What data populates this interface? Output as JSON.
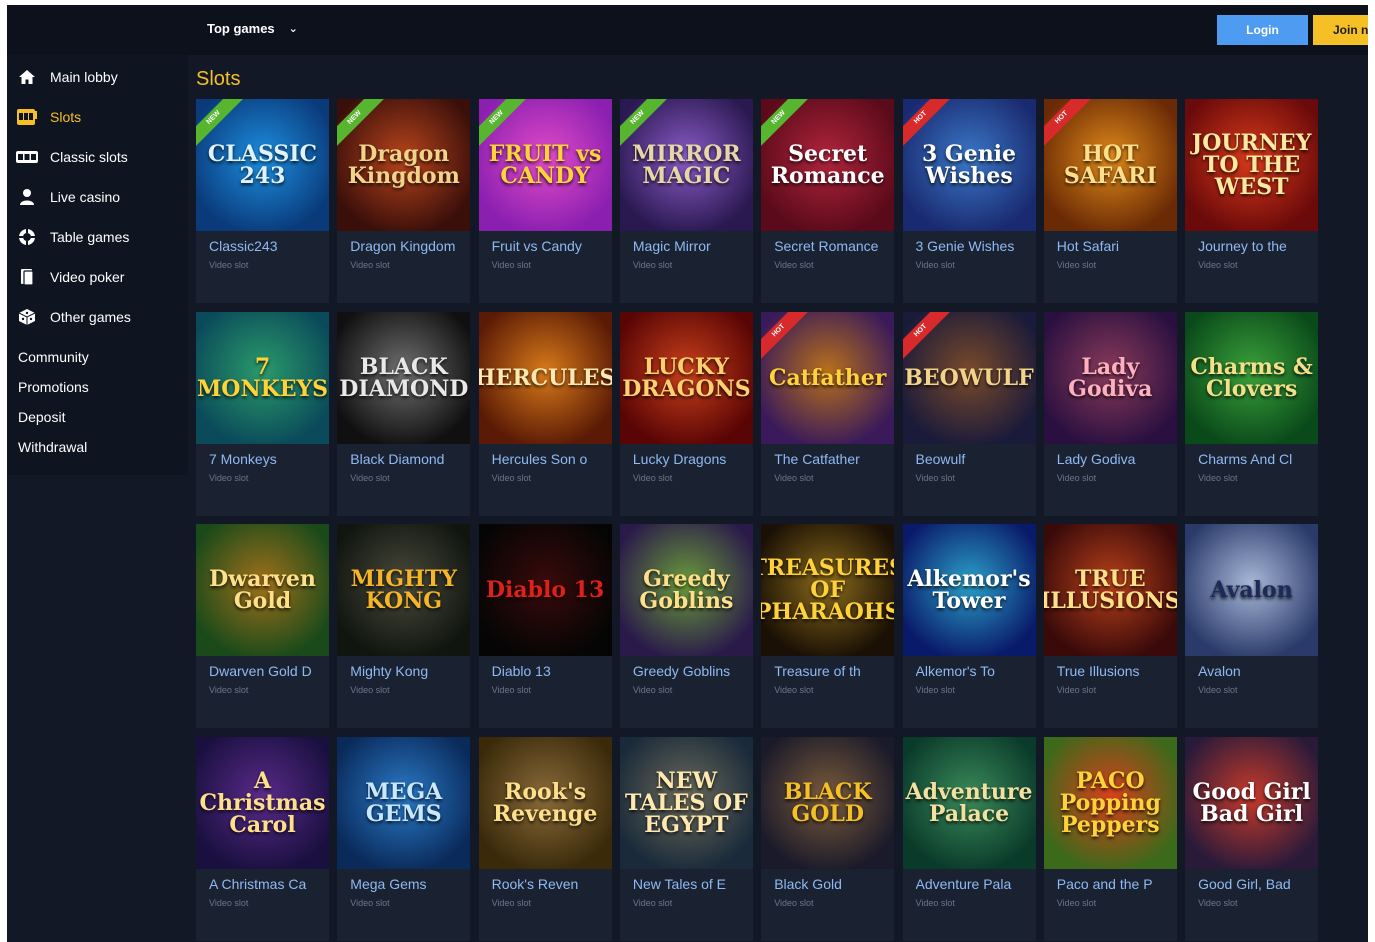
{
  "topbar": {
    "menu_label": "Top games",
    "login_label": "Login",
    "join_label": "Join n"
  },
  "sidebar": {
    "items": [
      {
        "label": "Main lobby",
        "icon": "home-icon",
        "active": false
      },
      {
        "label": "Slots",
        "icon": "slot-machine-icon",
        "active": true
      },
      {
        "label": "Classic slots",
        "icon": "classic-slots-icon",
        "active": false
      },
      {
        "label": "Live casino",
        "icon": "dealer-icon",
        "active": false
      },
      {
        "label": "Table games",
        "icon": "chip-icon",
        "active": false
      },
      {
        "label": "Video poker",
        "icon": "cards-icon",
        "active": false
      },
      {
        "label": "Other games",
        "icon": "dice-icon",
        "active": false
      }
    ],
    "links": [
      "Community",
      "Promotions",
      "Deposit",
      "Withdrawal"
    ]
  },
  "main": {
    "section_title": "Slots",
    "subtitle": "Video slot",
    "games": [
      {
        "name": "Classic243",
        "badge": "NEW",
        "art": "CLASSIC 243",
        "bg1": "#0a3a7a",
        "bg2": "#1c8fe0",
        "fg": "#dff3ff"
      },
      {
        "name": "Dragon Kingdom",
        "badge": "NEW",
        "art": "Dragon Kingdom",
        "bg1": "#3a0f0a",
        "bg2": "#b8441c",
        "fg": "#f2d38a"
      },
      {
        "name": "Fruit vs Candy",
        "badge": "NEW",
        "art": "FRUIT vs CANDY",
        "bg1": "#8a1fb0",
        "bg2": "#e24bc8",
        "fg": "#ffd23a"
      },
      {
        "name": "Magic Mirror",
        "badge": "NEW",
        "art": "MIRROR MAGIC",
        "bg1": "#2a1850",
        "bg2": "#8a5cc8",
        "fg": "#e8d6a8"
      },
      {
        "name": "Secret Romance",
        "badge": "NEW",
        "art": "Secret Romance",
        "bg1": "#5a0a1a",
        "bg2": "#b0243c",
        "fg": "#ffffff"
      },
      {
        "name": "3 Genie Wishes",
        "badge": "HOT",
        "art": "3 Genie Wishes",
        "bg1": "#1a2a70",
        "bg2": "#3a78c8",
        "fg": "#ffffff"
      },
      {
        "name": "Hot Safari",
        "badge": "HOT",
        "art": "HOT SAFARI",
        "bg1": "#6a2a05",
        "bg2": "#e08a1a",
        "fg": "#ffe08a"
      },
      {
        "name": "Journey to the",
        "badge": "",
        "art": "JOURNEY TO THE WEST",
        "bg1": "#6a0a0a",
        "bg2": "#d83a1a",
        "fg": "#ffe9a0"
      },
      {
        "name": "7 Monkeys",
        "badge": "",
        "art": "7 MONKEYS",
        "bg1": "#0a4a5a",
        "bg2": "#2a9a6a",
        "fg": "#ffd23a"
      },
      {
        "name": "Black Diamond",
        "badge": "",
        "art": "BLACK DIAMOND",
        "bg1": "#101010",
        "bg2": "#707070",
        "fg": "#e8e8e8"
      },
      {
        "name": "Hercules Son o",
        "badge": "",
        "art": "HERCULES",
        "bg1": "#5a1a05",
        "bg2": "#d87a1a",
        "fg": "#ffe9b0"
      },
      {
        "name": "Lucky Dragons",
        "badge": "",
        "art": "LUCKY DRAGONS",
        "bg1": "#5a0505",
        "bg2": "#c8401a",
        "fg": "#ffd070"
      },
      {
        "name": "The Catfather",
        "badge": "HOT",
        "art": "Catfather",
        "bg1": "#3a1a5a",
        "bg2": "#b8701a",
        "fg": "#ffd23a"
      },
      {
        "name": "Beowulf",
        "badge": "HOT",
        "art": "BEOWULF",
        "bg1": "#1a1a3a",
        "bg2": "#7a4a2a",
        "fg": "#f2d38a"
      },
      {
        "name": "Lady Godiva",
        "badge": "",
        "art": "Lady Godiva",
        "bg1": "#2a1040",
        "bg2": "#8a3a5a",
        "fg": "#ffb0c0"
      },
      {
        "name": "Charms And Cl",
        "badge": "",
        "art": "Charms & Clovers",
        "bg1": "#0a4a1a",
        "bg2": "#3aa03a",
        "fg": "#f2e08a"
      },
      {
        "name": "Dwarven Gold D",
        "badge": "",
        "art": "Dwarven Gold",
        "bg1": "#1a4a1a",
        "bg2": "#a0701a",
        "fg": "#ffe08a"
      },
      {
        "name": "Mighty Kong",
        "badge": "",
        "art": "MIGHTY KONG",
        "bg1": "#101510",
        "bg2": "#4a4a3a",
        "fg": "#f5b526"
      },
      {
        "name": "Diablo 13",
        "badge": "",
        "art": "Diablo 13",
        "bg1": "#050505",
        "bg2": "#3a0a0a",
        "fg": "#e0201a"
      },
      {
        "name": "Greedy Goblins",
        "badge": "",
        "art": "Greedy Goblins",
        "bg1": "#2a1a4a",
        "bg2": "#6a9a3a",
        "fg": "#ffe08a"
      },
      {
        "name": "Treasure of th",
        "badge": "",
        "art": "TREASURES OF PHARAOHS",
        "bg1": "#1a1005",
        "bg2": "#8a6a1a",
        "fg": "#ffd23a"
      },
      {
        "name": "Alkemor's To",
        "badge": "",
        "art": "Alkemor's Tower",
        "bg1": "#0a1a6a",
        "bg2": "#2aa0c8",
        "fg": "#ffffff"
      },
      {
        "name": "True Illusions",
        "badge": "",
        "art": "TRUE ILLUSIONS",
        "bg1": "#3a0a0a",
        "bg2": "#b8401a",
        "fg": "#ffe08a"
      },
      {
        "name": "Avalon",
        "badge": "",
        "art": "Avalon",
        "bg1": "#2a3a6a",
        "bg2": "#a8b8d8",
        "fg": "#1a2a5a"
      },
      {
        "name": "A Christmas Ca",
        "badge": "",
        "art": "A Christmas Carol",
        "bg1": "#1a1040",
        "bg2": "#5a2a8a",
        "fg": "#ffe08a"
      },
      {
        "name": "Mega Gems",
        "badge": "",
        "art": "MEGA GEMS",
        "bg1": "#0a2a5a",
        "bg2": "#2a7ac8",
        "fg": "#c8e8ff"
      },
      {
        "name": "Rook's Reven",
        "badge": "",
        "art": "Rook's Revenge",
        "bg1": "#3a2a0a",
        "bg2": "#8a6a3a",
        "fg": "#ffe08a"
      },
      {
        "name": "New Tales of E",
        "badge": "",
        "art": "NEW TALES OF EGYPT",
        "bg1": "#1a2a3a",
        "bg2": "#6a6a5a",
        "fg": "#ffe9b0"
      },
      {
        "name": "Black Gold",
        "badge": "",
        "art": "BLACK GOLD",
        "bg1": "#1a1a2a",
        "bg2": "#7a5a3a",
        "fg": "#f5c026"
      },
      {
        "name": "Adventure Pala",
        "badge": "",
        "art": "Adventure Palace",
        "bg1": "#0a3a2a",
        "bg2": "#3a8a5a",
        "fg": "#f2e0a0"
      },
      {
        "name": "Paco and the P",
        "badge": "",
        "art": "PACO Popping Peppers",
        "bg1": "#3a6a1a",
        "bg2": "#d8401a",
        "fg": "#ffd23a"
      },
      {
        "name": "Good Girl, Bad",
        "badge": "",
        "art": "Good Girl Bad Girl",
        "bg1": "#2a1a3a",
        "bg2": "#c83a2a",
        "fg": "#ffffff"
      }
    ]
  }
}
